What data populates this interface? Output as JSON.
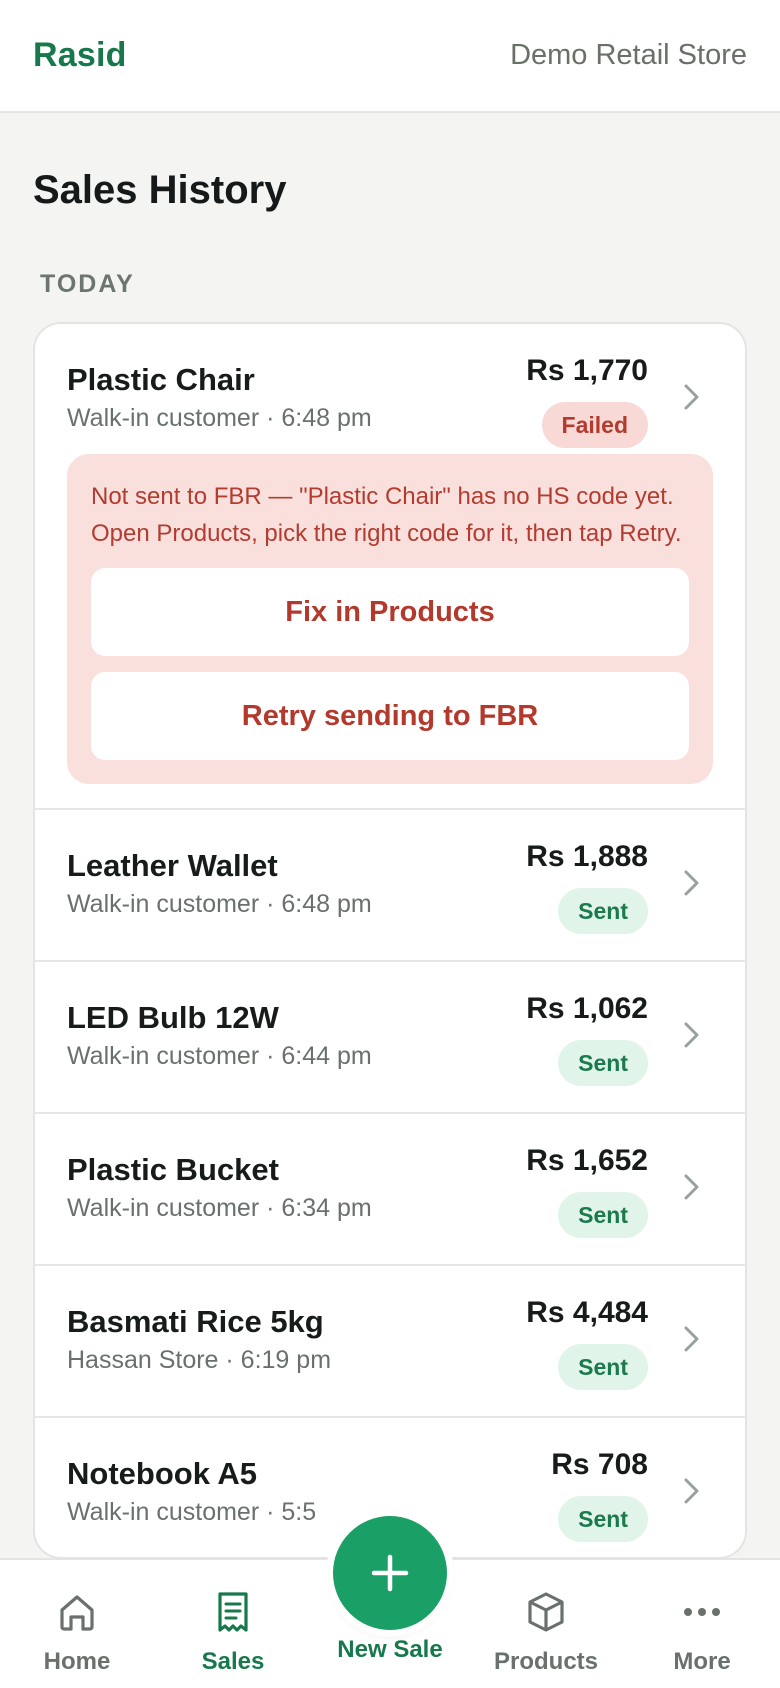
{
  "header": {
    "brand": "Rasid",
    "store_name": "Demo Retail Store"
  },
  "page": {
    "title": "Sales History",
    "section": "TODAY"
  },
  "colors": {
    "brand_green": "#17784c",
    "fab_green": "#1a9f66",
    "failed_red": "#b23a2e",
    "sent_green": "#1a7a4d"
  },
  "sales": [
    {
      "name": "Plastic Chair",
      "sub": "Walk-in customer · 6:48 pm",
      "amount": "Rs 1,770",
      "status": "Failed",
      "error": "Not sent to FBR — \"Plastic Chair\" has no HS code yet. Open Products, pick the right code for it, then tap Retry.",
      "fix_label": "Fix in Products",
      "retry_label": "Retry sending to FBR"
    },
    {
      "name": "Leather Wallet",
      "sub": "Walk-in customer · 6:48 pm",
      "amount": "Rs 1,888",
      "status": "Sent"
    },
    {
      "name": "LED Bulb 12W",
      "sub": "Walk-in customer · 6:44 pm",
      "amount": "Rs 1,062",
      "status": "Sent"
    },
    {
      "name": "Plastic Bucket",
      "sub": "Walk-in customer · 6:34 pm",
      "amount": "Rs 1,652",
      "status": "Sent"
    },
    {
      "name": "Basmati Rice 5kg",
      "sub": "Hassan Store · 6:19 pm",
      "amount": "Rs 4,484",
      "status": "Sent"
    },
    {
      "name": "Notebook A5",
      "sub": "Walk-in customer · 5:5",
      "amount": "Rs 708",
      "status": "Sent"
    }
  ],
  "nav": {
    "home": "Home",
    "sales": "Sales",
    "new_sale": "New Sale",
    "products": "Products",
    "more": "More"
  },
  "icons": {
    "home": "home-icon",
    "sales": "receipt-icon",
    "new_sale": "plus-icon",
    "products": "box-icon",
    "more": "more-dots-icon",
    "row": "chevron-right-icon"
  }
}
